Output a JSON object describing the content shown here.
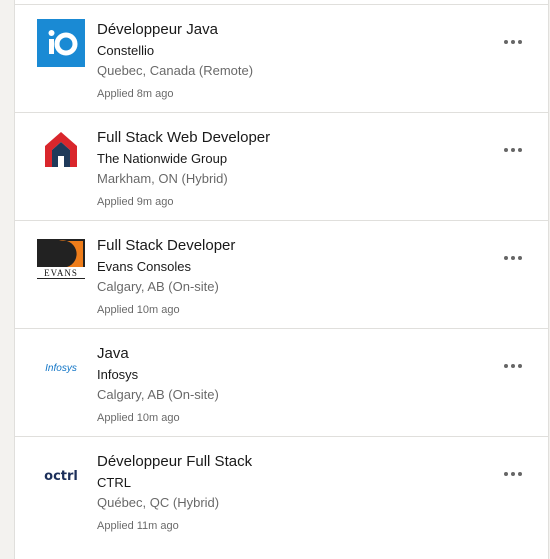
{
  "jobs": [
    {
      "title": "Développeur Java",
      "company": "Constellio",
      "location": "Quebec, Canada (Remote)",
      "applied": "Applied 8m ago",
      "logo": "constellio-logo",
      "more_icon": "ellipsis-icon"
    },
    {
      "title": "Full Stack Web Developer",
      "company": "The Nationwide Group",
      "location": "Markham, ON (Hybrid)",
      "applied": "Applied 9m ago",
      "logo": "nationwide-logo",
      "more_icon": "ellipsis-icon"
    },
    {
      "title": "Full Stack Developer",
      "company": "Evans Consoles",
      "location": "Calgary, AB (On-site)",
      "applied": "Applied 10m ago",
      "logo": "evans-logo",
      "logo_text": "EVANS",
      "more_icon": "ellipsis-icon"
    },
    {
      "title": "Java",
      "company": "Infosys",
      "location": "Calgary, AB (On-site)",
      "applied": "Applied 10m ago",
      "logo": "infosys-logo",
      "logo_text": "Infosys",
      "more_icon": "ellipsis-icon"
    },
    {
      "title": "Développeur Full Stack",
      "company": "CTRL",
      "location": "Québec, QC (Hybrid)",
      "applied": "Applied 11m ago",
      "logo": "ctrl-logo",
      "logo_text": "octrl",
      "more_icon": "ellipsis-icon"
    }
  ],
  "colors": {
    "constellio": "#1a8ad4",
    "nationwide_red": "#d9262c",
    "nationwide_navy": "#1f3a5a",
    "evans_orange": "#ef7d1a",
    "infosys_blue": "#1175c7",
    "ctrl_navy": "#1c2f5a"
  }
}
